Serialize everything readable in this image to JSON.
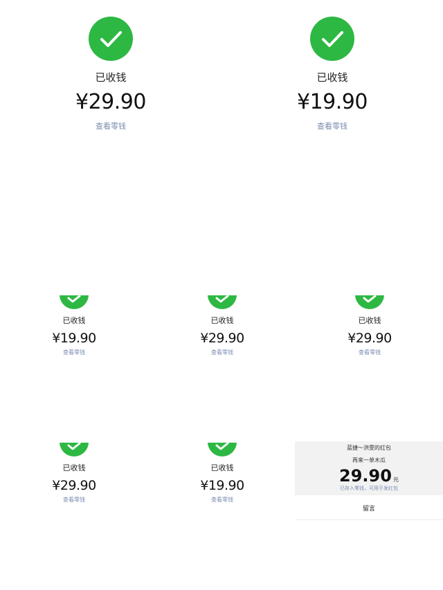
{
  "colors": {
    "success_green": "#2db843",
    "link_blue_gray": "#7a8bb0"
  },
  "tiles": [
    {
      "label": "已收钱",
      "amount": "¥29.90",
      "link": "查看零钱"
    },
    {
      "label": "已收钱",
      "amount": "¥19.90",
      "link": "查看零钱"
    },
    {
      "label": "已收钱",
      "amount": "¥19.90",
      "link": "查看零钱"
    },
    {
      "label": "已收钱",
      "amount": "¥29.90",
      "link": "查看零钱"
    },
    {
      "label": "已收钱",
      "amount": "¥29.90",
      "link": "查看零钱"
    },
    {
      "label": "已收钱",
      "amount": "¥29.90",
      "link": "查看零钱"
    },
    {
      "label": "已收钱",
      "amount": "¥19.90",
      "link": "查看零钱"
    }
  ],
  "icons": {
    "status": "checkmark-circle-icon"
  },
  "red_packet": {
    "sender": "蓝捷～洪雯的红包",
    "note": "再来一单木瓜",
    "amount": "29.90",
    "unit": "元",
    "saved_text": "已存入零钱，可用于发红包",
    "reply_label": "留言"
  }
}
